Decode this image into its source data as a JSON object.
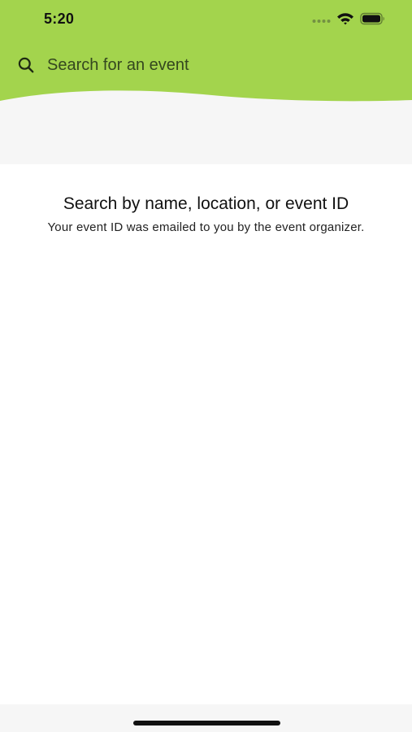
{
  "status_bar": {
    "time": "5:20"
  },
  "search": {
    "placeholder": "Search for an event",
    "value": ""
  },
  "empty_state": {
    "title": "Search by name, location, or event ID",
    "subtitle": "Your event ID was emailed to you by the event organizer."
  },
  "colors": {
    "header_green": "#a3d44d",
    "background": "#ffffff",
    "band_gray": "#f6f6f6",
    "text_dark": "#111111"
  },
  "icons": {
    "search": "search-icon",
    "wifi": "wifi-icon",
    "battery": "battery-icon",
    "cellular": "cellular-signal-icon"
  }
}
